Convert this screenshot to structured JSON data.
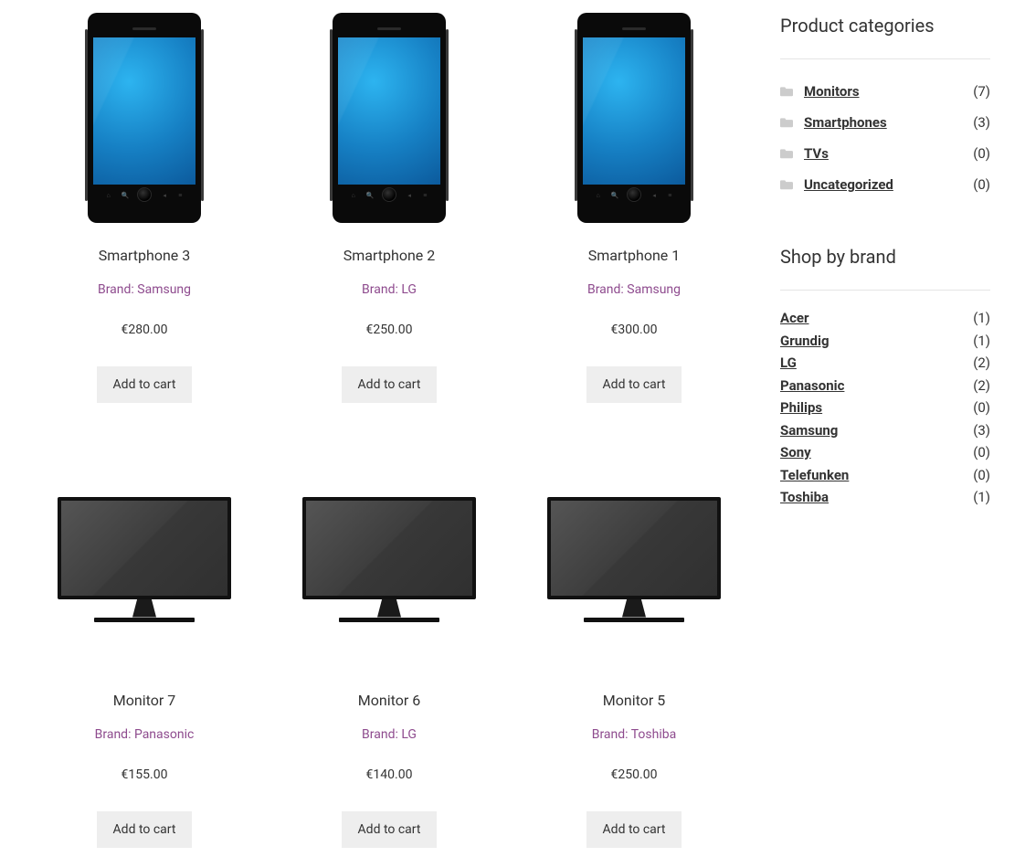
{
  "add_to_cart_label": "Add to cart",
  "products": [
    {
      "title": "Smartphone 3",
      "brand_line": "Brand: Samsung",
      "price": "€280.00",
      "kind": "phone"
    },
    {
      "title": "Smartphone 2",
      "brand_line": "Brand: LG",
      "price": "€250.00",
      "kind": "phone"
    },
    {
      "title": "Smartphone 1",
      "brand_line": "Brand: Samsung",
      "price": "€300.00",
      "kind": "phone"
    },
    {
      "title": "Monitor 7",
      "brand_line": "Brand: Panasonic",
      "price": "€155.00",
      "kind": "monitor"
    },
    {
      "title": "Monitor 6",
      "brand_line": "Brand: LG",
      "price": "€140.00",
      "kind": "monitor"
    },
    {
      "title": "Monitor 5",
      "brand_line": "Brand: Toshiba",
      "price": "€250.00",
      "kind": "monitor"
    }
  ],
  "sidebar": {
    "categories_title": "Product categories",
    "categories": [
      {
        "name": "Monitors",
        "count": "(7)"
      },
      {
        "name": "Smartphones",
        "count": "(3)"
      },
      {
        "name": "TVs",
        "count": "(0)"
      },
      {
        "name": "Uncategorized",
        "count": "(0)"
      }
    ],
    "brands_title": "Shop by brand",
    "brands": [
      {
        "name": "Acer",
        "count": "(1)"
      },
      {
        "name": "Grundig",
        "count": "(1)"
      },
      {
        "name": "LG",
        "count": "(2)"
      },
      {
        "name": "Panasonic",
        "count": "(2)"
      },
      {
        "name": "Philips",
        "count": "(0)"
      },
      {
        "name": "Samsung",
        "count": "(3)"
      },
      {
        "name": "Sony",
        "count": "(0)"
      },
      {
        "name": "Telefunken",
        "count": "(0)"
      },
      {
        "name": "Toshiba",
        "count": "(1)"
      }
    ]
  }
}
